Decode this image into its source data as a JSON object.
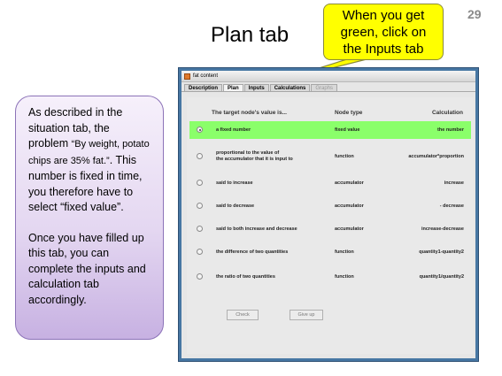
{
  "slide": {
    "number": "29",
    "title": "Plan tab"
  },
  "callout": {
    "lines": [
      "When you get",
      "green, click on",
      "the Inputs tab"
    ],
    "color": "#ffff00"
  },
  "note": {
    "p1_a": "As described in the situation tab, the problem ",
    "p1_quote": "“By weight, potato chips are 35% fat.”",
    "p1_b": ". This number is fixed in time, you therefore have to select “fixed value”.",
    "p2": "Once you have filled up this tab, you can complete the inputs and calculation tab accordingly."
  },
  "window": {
    "title": "fat content",
    "tabs": [
      {
        "label": "Description",
        "state": "normal"
      },
      {
        "label": "Plan",
        "state": "active"
      },
      {
        "label": "Inputs",
        "state": "normal"
      },
      {
        "label": "Calculations",
        "state": "normal"
      },
      {
        "label": "Graphs",
        "state": "disabled"
      }
    ],
    "columns": {
      "description": "The target node's value is...",
      "type": "Node type",
      "calculation": "Calculation"
    },
    "rows": [
      {
        "desc": "a fixed number",
        "type": "fixed value",
        "calc": "the number",
        "selected": true
      },
      {
        "desc": "proportional to the value of",
        "desc2": "the accumulator that it is input to",
        "type": "function",
        "calc": "accumulator*proportion",
        "selected": false
      },
      {
        "desc": "said to increase",
        "type": "accumulator",
        "calc": "increase",
        "selected": false
      },
      {
        "desc": "said to decrease",
        "type": "accumulator",
        "calc": "- decrease",
        "selected": false
      },
      {
        "desc": "said to both increase and decrease",
        "type": "accumulator",
        "calc": "increase-decrease",
        "selected": false
      },
      {
        "desc": "the difference of two quantities",
        "type": "function",
        "calc": "quantity1-quantity2",
        "selected": false
      },
      {
        "desc": "the ratio of two quantities",
        "type": "function",
        "calc": "quantity1/quantity2",
        "selected": false
      }
    ],
    "buttons": {
      "check": "Check",
      "give_up": "Give up"
    },
    "highlight_color": "#8aff6a"
  }
}
